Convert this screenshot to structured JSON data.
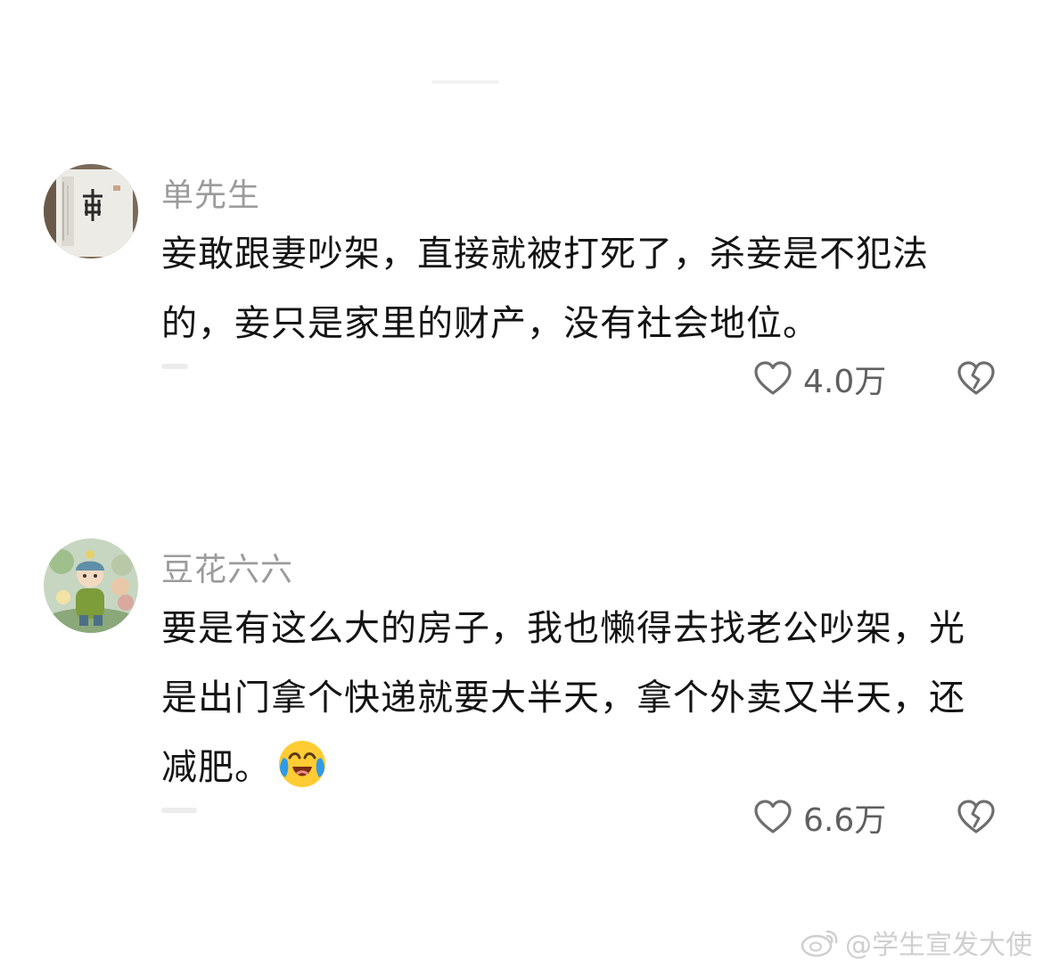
{
  "comments": [
    {
      "username": "单先生",
      "text": "妾敢跟妻吵架，直接就被打死了，杀妾是不犯法的，妾只是家里的财产，没有社会地位。",
      "likes": "4.0万",
      "avatar_icon": "calligraphy-avatar-icon"
    },
    {
      "username": "豆花六六",
      "text": "要是有这么大的房子，我也懒得去找老公吵架，光是出门拿个快递就要大半天，拿个外卖又半天，还减肥。",
      "likes": "6.6万",
      "emoji": "crying-laughing-emoji",
      "avatar_icon": "cartoon-kid-avatar-icon"
    }
  ],
  "watermark": {
    "text": "@学生宣发大使",
    "icon": "weibo-icon"
  },
  "colors": {
    "username": "#9b9b9b",
    "text": "#141414",
    "count": "#5f5f5f",
    "icon_stroke": "#6e6e6e"
  }
}
